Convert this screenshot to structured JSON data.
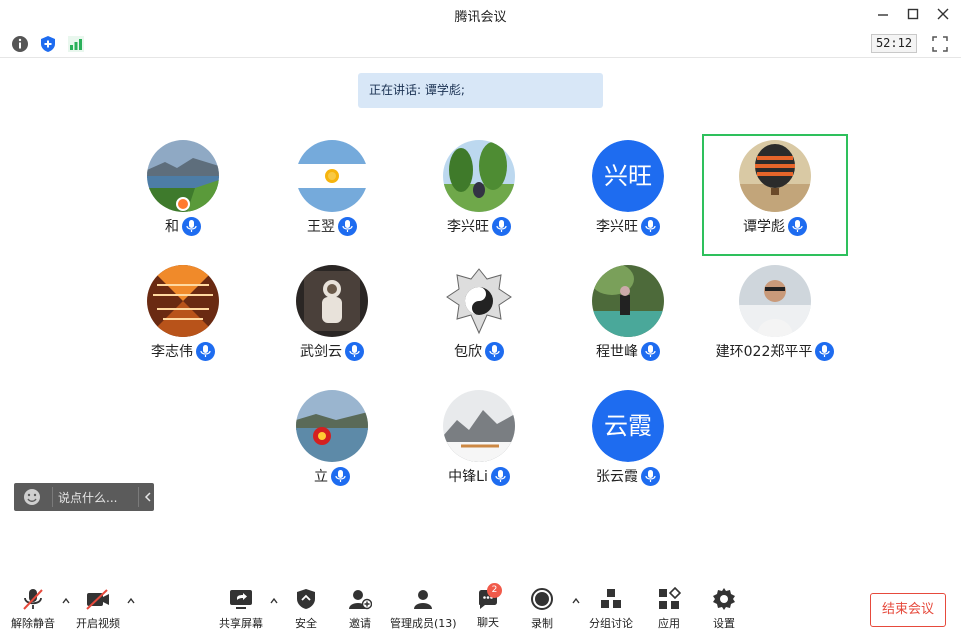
{
  "window": {
    "title": "腾讯会议"
  },
  "infobar": {
    "timer": "52:12",
    "icons": [
      "info-icon",
      "shield-icon",
      "signal-icon",
      "fullscreen-icon"
    ]
  },
  "speaking": {
    "text": "正在讲话: 谭学彪;"
  },
  "participants": [
    {
      "name": "和",
      "avatar": "photo-lake",
      "host": true
    },
    {
      "name": "王翌",
      "avatar": "photo-argentina-flag"
    },
    {
      "name": "李兴旺",
      "avatar": "photo-park"
    },
    {
      "name": "李兴旺",
      "avatar_text": "兴旺"
    },
    {
      "name": "谭学彪",
      "avatar": "photo-balloon",
      "active_speaker": true
    },
    {
      "name": "李志伟",
      "avatar": "photo-architecture"
    },
    {
      "name": "武剑云",
      "avatar": "photo-astronaut"
    },
    {
      "name": "包欣",
      "avatar": "photo-yin-yang"
    },
    {
      "name": "程世峰",
      "avatar": "photo-river"
    },
    {
      "name": "建环022郑平平",
      "avatar": "photo-person"
    },
    {
      "name": "立",
      "avatar": "photo-red-flower"
    },
    {
      "name": "中锋Li",
      "avatar": "photo-snow"
    },
    {
      "name": "张云霞",
      "avatar_text": "云霞"
    }
  ],
  "chat": {
    "placeholder": "说点什么..."
  },
  "toolbar": {
    "unmute": "解除静音",
    "start_video": "开启视频",
    "share_screen": "共享屏幕",
    "security": "安全",
    "invite": "邀请",
    "manage_members": "管理成员(13)",
    "chat": "聊天",
    "chat_badge": "2",
    "record": "录制",
    "breakout": "分组讨论",
    "apps": "应用",
    "settings": "设置",
    "end_meeting": "结束会议"
  },
  "colors": {
    "accent": "#1e6cf0",
    "active_border": "#2ec05c",
    "end_red": "#e64a3c",
    "banner": "#d8e7f7"
  }
}
